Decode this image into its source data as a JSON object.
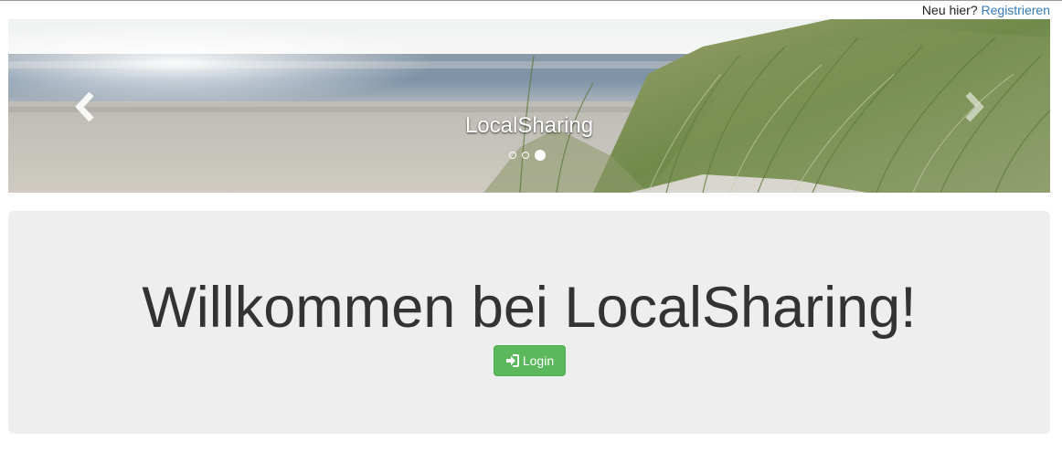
{
  "topbar": {
    "prompt": "Neu hier?",
    "register_link": "Registrieren",
    "link_color": "#337ab7"
  },
  "carousel": {
    "caption": "LocalSharing",
    "indicator_count": 3,
    "active_index": 2,
    "controls": {
      "prev_icon": "chevron-left-icon",
      "next_icon": "chevron-right-icon"
    }
  },
  "jumbotron": {
    "heading": "Willkommen bei LocalSharing!",
    "login_label": "Login",
    "login_icon": "login-icon",
    "button_color": "#5cb85c",
    "background": "#eeeeee"
  }
}
